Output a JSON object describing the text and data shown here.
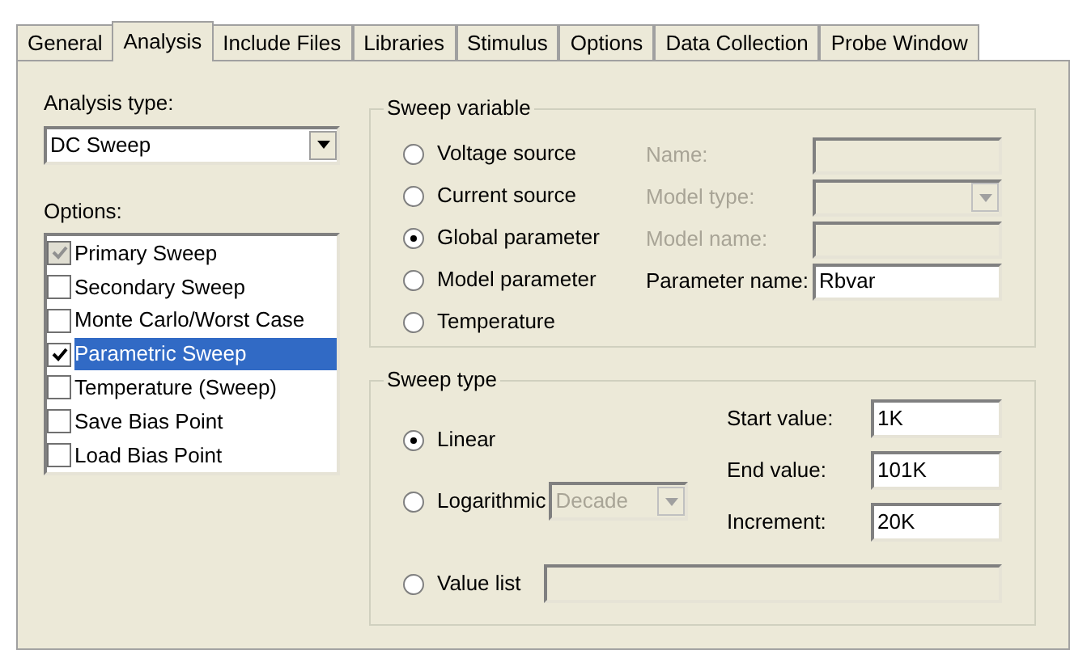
{
  "tabs": [
    {
      "label": "General",
      "selected": false
    },
    {
      "label": "Analysis",
      "selected": true
    },
    {
      "label": "Include Files",
      "selected": false
    },
    {
      "label": "Libraries",
      "selected": false
    },
    {
      "label": "Stimulus",
      "selected": false
    },
    {
      "label": "Options",
      "selected": false
    },
    {
      "label": "Data Collection",
      "selected": false
    },
    {
      "label": "Probe Window",
      "selected": false
    }
  ],
  "analysis_type": {
    "label": "Analysis type:",
    "value": "DC Sweep"
  },
  "options": {
    "label": "Options:",
    "items": [
      {
        "label": "Primary Sweep",
        "checked": true,
        "disabled": true,
        "selected": false
      },
      {
        "label": "Secondary Sweep",
        "checked": false,
        "disabled": false,
        "selected": false
      },
      {
        "label": "Monte Carlo/Worst Case",
        "checked": false,
        "disabled": false,
        "selected": false
      },
      {
        "label": "Parametric Sweep",
        "checked": true,
        "disabled": false,
        "selected": true
      },
      {
        "label": "Temperature (Sweep)",
        "checked": false,
        "disabled": false,
        "selected": false
      },
      {
        "label": "Save Bias Point",
        "checked": false,
        "disabled": false,
        "selected": false
      },
      {
        "label": "Load Bias Point",
        "checked": false,
        "disabled": false,
        "selected": false
      }
    ]
  },
  "sweep_variable": {
    "title": "Sweep variable",
    "radios": [
      {
        "label": "Voltage source",
        "selected": false
      },
      {
        "label": "Current source",
        "selected": false
      },
      {
        "label": "Global parameter",
        "selected": true
      },
      {
        "label": "Model parameter",
        "selected": false
      },
      {
        "label": "Temperature",
        "selected": false
      }
    ],
    "fields": [
      {
        "label": "Name:",
        "kind": "text",
        "disabled": true
      },
      {
        "label": "Model type:",
        "kind": "select",
        "disabled": true
      },
      {
        "label": "Model name:",
        "kind": "text",
        "disabled": true
      },
      {
        "label": "Parameter name:",
        "kind": "text",
        "disabled": false,
        "value": "Rbvar"
      }
    ]
  },
  "sweep_type": {
    "title": "Sweep type",
    "linear": {
      "label": "Linear",
      "selected": true
    },
    "logarithmic": {
      "label": "Logarithmic",
      "selected": false,
      "scale": "Decade",
      "disabled": true
    },
    "value_list": {
      "label": "Value list",
      "selected": false
    },
    "fields": [
      {
        "label": "Start value:",
        "value": "1K"
      },
      {
        "label": "End value:",
        "value": "101K"
      },
      {
        "label": "Increment:",
        "value": "20K"
      }
    ]
  }
}
